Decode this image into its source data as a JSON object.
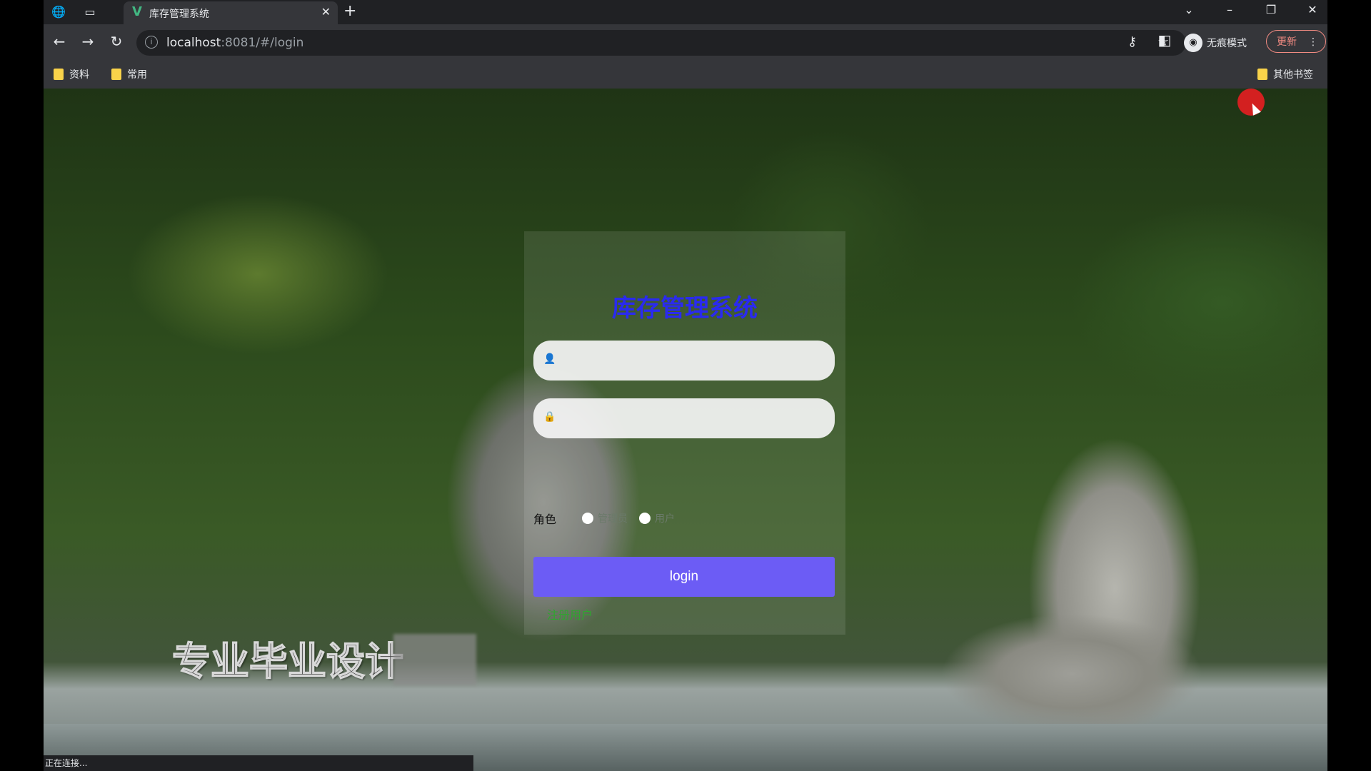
{
  "browser": {
    "tab_title": "库存管理系统",
    "url_host": "localhost",
    "url_path": ":8081/#/login",
    "incognito_label": "无痕模式",
    "update_label": "更新",
    "bookmarks": [
      "资料",
      "常用"
    ],
    "other_bookmarks": "其他书签",
    "status_text": "正在连接..."
  },
  "login": {
    "system_title": "库存管理系统",
    "username_value": "",
    "password_value": "",
    "role_label": "角色",
    "role_options": [
      "管理员",
      "用户"
    ],
    "login_button": "login",
    "register_link": "注册用户"
  },
  "overlay": {
    "watermark": "专业毕业设计"
  },
  "colors": {
    "title": "#2a2af0",
    "login_button": "#6c5cf5",
    "register_link": "#2fa52f",
    "cursor_highlight": "#d32020"
  }
}
